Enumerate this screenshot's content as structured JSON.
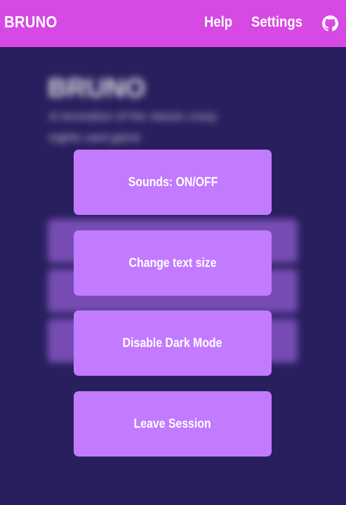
{
  "navbar": {
    "brand": "BRUNO",
    "help_label": "Help",
    "settings_label": "Settings",
    "github_icon": "github-icon",
    "background_color": "#d649e5"
  },
  "background": {
    "title": "BRUNO",
    "description": "A recreation of the classic crazy eights card game",
    "cards": [
      "",
      "",
      ""
    ],
    "color": "#291f5e"
  },
  "menu": {
    "sounds_label": "Sounds: ON/OFF",
    "text_size_label": "Change text size",
    "dark_mode_label": "Disable Dark Mode",
    "leave_label": "Leave Session",
    "button_color": "#c27bff"
  }
}
